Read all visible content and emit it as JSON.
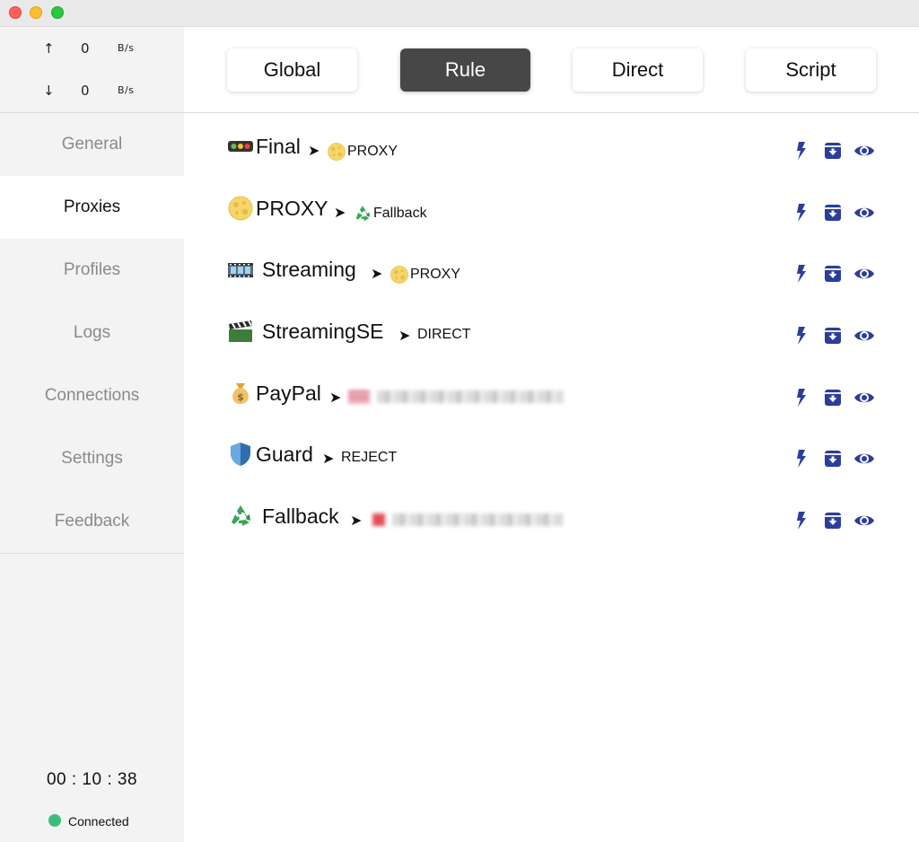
{
  "traffic": {
    "up_arrow": "↑",
    "up_value": "0",
    "up_unit": "B/s",
    "down_arrow": "↓",
    "down_value": "0",
    "down_unit": "B/s"
  },
  "sidebar": {
    "items": [
      {
        "label": "General"
      },
      {
        "label": "Proxies",
        "active": true
      },
      {
        "label": "Profiles"
      },
      {
        "label": "Logs"
      },
      {
        "label": "Connections"
      },
      {
        "label": "Settings"
      },
      {
        "label": "Feedback"
      }
    ],
    "timer": "00 : 10 : 38",
    "status": "Connected",
    "status_color": "#3dbd7d"
  },
  "modes": {
    "items": [
      {
        "label": "Global"
      },
      {
        "label": "Rule",
        "active": true
      },
      {
        "label": "Direct"
      },
      {
        "label": "Script"
      }
    ]
  },
  "proxies": [
    {
      "name": "Final",
      "icon": "traffic-light-icon",
      "arrow": "➤",
      "target": "PROXY",
      "target_icon": "moon-icon"
    },
    {
      "name": "PROXY",
      "icon": "moon-icon",
      "arrow": "➤",
      "target": "Fallback",
      "target_icon": "recycle-icon"
    },
    {
      "name": "Streaming",
      "icon": "film-strip-icon",
      "arrow": "➤",
      "target": "PROXY",
      "target_icon": "moon-icon"
    },
    {
      "name": "StreamingSE",
      "icon": "clapper-board-icon",
      "arrow": "➤",
      "target": "DIRECT",
      "target_icon": ""
    },
    {
      "name": "PayPal",
      "icon": "money-bag-icon",
      "arrow": "➤",
      "target": "",
      "target_icon": "us-flag-icon"
    },
    {
      "name": "Guard",
      "icon": "shield-icon",
      "arrow": "➤",
      "target": "REJECT",
      "target_icon": ""
    },
    {
      "name": "Fallback",
      "icon": "recycle-icon",
      "arrow": "➤",
      "target": "",
      "target_icon": "red-flag-icon"
    }
  ],
  "colors": {
    "accent": "#2c3e9a",
    "active_mode_bg": "#474747",
    "sidebar_bg": "#f3f3f3",
    "nav_inactive_text": "#8a8a8a"
  }
}
